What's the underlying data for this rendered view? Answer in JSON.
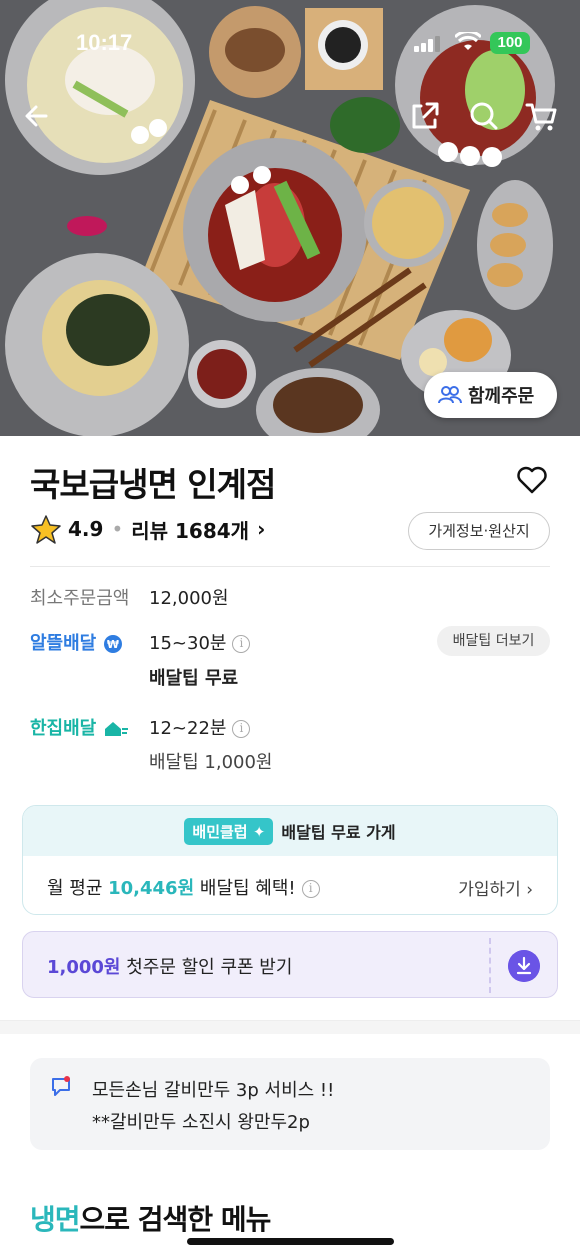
{
  "status_bar": {
    "time": "10:17",
    "battery": "100"
  },
  "hero": {
    "together_order_label": "함께주문",
    "icons": [
      "back-arrow-icon",
      "share-icon",
      "search-icon",
      "cart-icon",
      "people-icon"
    ]
  },
  "store": {
    "name": "국보급냉면 인계점",
    "rating": "4.9",
    "review_label": "리뷰 1684개",
    "info_button": "가게정보·원산지"
  },
  "order_info": {
    "min_order_label": "최소주문금액",
    "min_order_value": "12,000원",
    "saver_delivery": {
      "brand": "알뜰배달",
      "time": "15~30분",
      "tip": "배달팁 무료",
      "tip_more_button": "배달팁 더보기"
    },
    "single_delivery": {
      "brand": "한집배달",
      "time": "12~22분",
      "tip": "배달팁 1,000원"
    }
  },
  "club": {
    "badge": "배민클럽",
    "headline": "배달팁 무료 가게",
    "prefix": "월 평균 ",
    "amount": "10,446원",
    "suffix": " 배달팁 혜택!",
    "join": "가입하기"
  },
  "coupon": {
    "amount": "1,000원",
    "text": " 첫주문 할인 쿠폰 받기"
  },
  "notice": {
    "line1": "모든손님 갈비만두 3p 서비스 !!",
    "line2": "**갈비만두 소진시 왕만두2p"
  },
  "menu_search": {
    "keyword": "냉면",
    "suffix": "으로 검색한 메뉴"
  },
  "colors": {
    "mint": "#2ab7bb",
    "saver_blue": "#2f7de1",
    "single_teal": "#19b5a6",
    "coupon_purple": "#6a54e6"
  }
}
